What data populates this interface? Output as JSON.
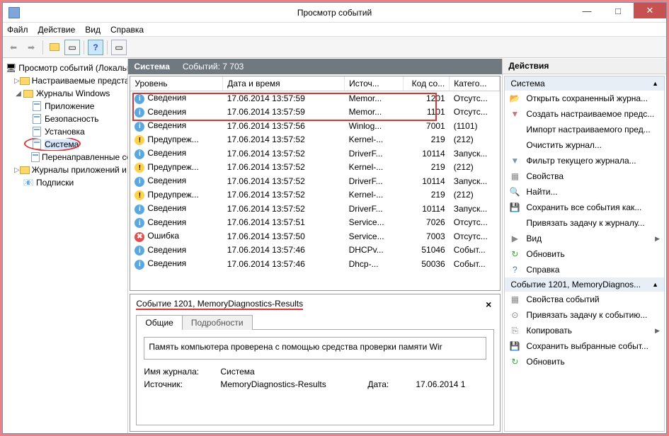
{
  "window": {
    "title": "Просмотр событий"
  },
  "menu": {
    "file": "Файл",
    "action": "Действие",
    "view": "Вид",
    "help": "Справка"
  },
  "tree": {
    "root": "Просмотр событий (Локальны",
    "custom": "Настраиваемые представл",
    "winlogs": "Журналы Windows",
    "app": "Приложение",
    "security": "Безопасность",
    "setup": "Установка",
    "system": "Система",
    "forwarded": "Перенаправленные соб",
    "applogs": "Журналы приложений и сл",
    "subs": "Подписки"
  },
  "centerHeader": {
    "name": "Система",
    "count": "Событий: 7 703"
  },
  "cols": {
    "level": "Уровень",
    "date": "Дата и время",
    "source": "Источ...",
    "code": "Код со...",
    "cat": "Катего..."
  },
  "levels": {
    "info": "Сведения",
    "warn": "Предупреж...",
    "err": "Ошибка"
  },
  "rows": [
    {
      "lvl": "info",
      "date": "17.06.2014 13:57:59",
      "src": "Memor...",
      "code": "1201",
      "cat": "Отсутс..."
    },
    {
      "lvl": "info",
      "date": "17.06.2014 13:57:59",
      "src": "Memor...",
      "code": "1101",
      "cat": "Отсутс..."
    },
    {
      "lvl": "info",
      "date": "17.06.2014 13:57:56",
      "src": "Winlog...",
      "code": "7001",
      "cat": "(1101)"
    },
    {
      "lvl": "warn",
      "date": "17.06.2014 13:57:52",
      "src": "Kernel-...",
      "code": "219",
      "cat": "(212)"
    },
    {
      "lvl": "info",
      "date": "17.06.2014 13:57:52",
      "src": "DriverF...",
      "code": "10114",
      "cat": "Запуск..."
    },
    {
      "lvl": "warn",
      "date": "17.06.2014 13:57:52",
      "src": "Kernel-...",
      "code": "219",
      "cat": "(212)"
    },
    {
      "lvl": "info",
      "date": "17.06.2014 13:57:52",
      "src": "DriverF...",
      "code": "10114",
      "cat": "Запуск..."
    },
    {
      "lvl": "warn",
      "date": "17.06.2014 13:57:52",
      "src": "Kernel-...",
      "code": "219",
      "cat": "(212)"
    },
    {
      "lvl": "info",
      "date": "17.06.2014 13:57:52",
      "src": "DriverF...",
      "code": "10114",
      "cat": "Запуск..."
    },
    {
      "lvl": "info",
      "date": "17.06.2014 13:57:51",
      "src": "Service...",
      "code": "7026",
      "cat": "Отсутс..."
    },
    {
      "lvl": "err",
      "date": "17.06.2014 13:57:50",
      "src": "Service...",
      "code": "7003",
      "cat": "Отсутс..."
    },
    {
      "lvl": "info",
      "date": "17.06.2014 13:57:46",
      "src": "DHCPv...",
      "code": "51046",
      "cat": "Событ..."
    },
    {
      "lvl": "info",
      "date": "17.06.2014 13:57:46",
      "src": "Dhcp-...",
      "code": "50036",
      "cat": "Событ..."
    }
  ],
  "detail": {
    "title": "Событие 1201, MemoryDiagnostics-Results",
    "tab1": "Общие",
    "tab2": "Подробности",
    "text": "Память компьютера проверена с помощью средства проверки памяти Wir",
    "logLabel": "Имя журнала:",
    "logVal": "Система",
    "srcLabel": "Источник:",
    "srcVal": "MemoryDiagnostics-Results",
    "dateLabel": "Дата:",
    "dateVal": "17.06.2014 1"
  },
  "actions": {
    "title": "Действия",
    "section1": "Система",
    "items1": [
      {
        "ico": "📂",
        "t": "Открыть сохраненный журна..."
      },
      {
        "ico": "▼",
        "t": "Создать настраиваемое предс...",
        "col": "#c77"
      },
      {
        "ico": "",
        "t": "Импорт настраиваемого пред..."
      },
      {
        "ico": "",
        "t": "Очистить журнал..."
      },
      {
        "ico": "▼",
        "t": "Фильтр текущего журнала...",
        "col": "#79a"
      },
      {
        "ico": "▦",
        "t": "Свойства"
      },
      {
        "ico": "🔍",
        "t": "Найти..."
      },
      {
        "ico": "💾",
        "t": "Сохранить все события как..."
      },
      {
        "ico": "",
        "t": "Привязать задачу к журналу..."
      },
      {
        "ico": "▶",
        "t": "Вид"
      },
      {
        "ico": "↻",
        "t": "Обновить",
        "col": "#3a3"
      },
      {
        "ico": "?",
        "t": "Справка",
        "col": "#37c"
      }
    ],
    "section2": "Событие 1201, MemoryDiagnos...",
    "items2": [
      {
        "ico": "▦",
        "t": "Свойства событий"
      },
      {
        "ico": "⊙",
        "t": "Привязать задачу к событию..."
      },
      {
        "ico": "⎘",
        "t": "Копировать"
      },
      {
        "ico": "💾",
        "t": "Сохранить выбранные событ..."
      },
      {
        "ico": "↻",
        "t": "Обновить",
        "col": "#3a3"
      }
    ]
  }
}
